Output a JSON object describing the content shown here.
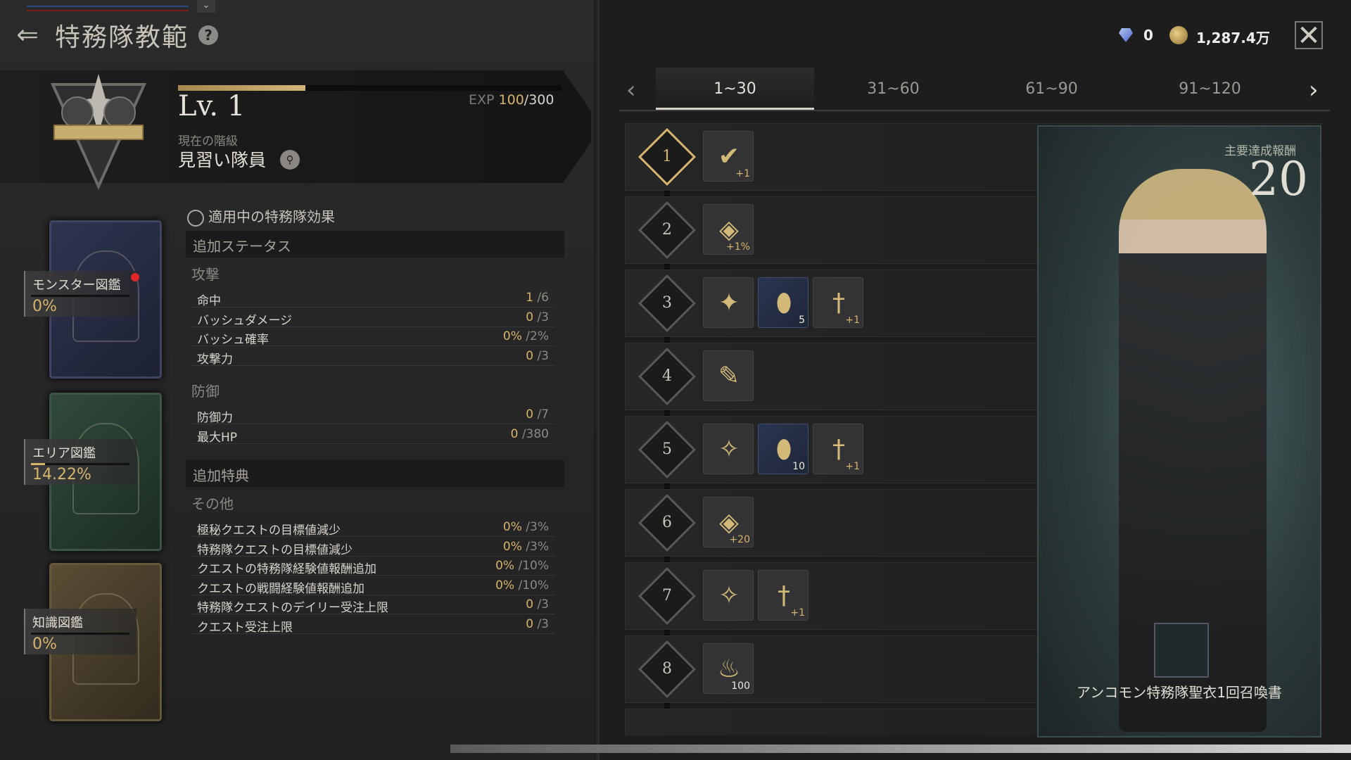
{
  "header": {
    "title": "特務隊教範",
    "help": "?",
    "back_icon": "back-arrow-icon"
  },
  "status": {
    "level": "Lv. 1",
    "exp_prefix": "EXP",
    "exp_current": "100",
    "exp_max": "/300",
    "exp_progress": 0.333,
    "rank_label": "現在の階級",
    "rank": "見習い隊員"
  },
  "books": [
    {
      "name": "モンスター図鑑",
      "percent": "0%",
      "progress": 0.0,
      "color": "#2e3450",
      "new": true
    },
    {
      "name": "エリア図鑑",
      "percent": "14.22%",
      "progress": 0.1422,
      "color": "#304a3c",
      "new": false
    },
    {
      "name": "知識図鑑",
      "percent": "0%",
      "progress": 0.0,
      "color": "#5a4d35",
      "new": false
    }
  ],
  "effects": {
    "title": "適用中の特務隊効果",
    "section1": "追加ステータス",
    "attack_label": "攻撃",
    "attack_rows": [
      {
        "label": "命中",
        "cur": "1",
        "max": "/6"
      },
      {
        "label": "バッシュダメージ",
        "cur": "0",
        "max": "/3"
      },
      {
        "label": "バッシュ確率",
        "cur": "0%",
        "max": "/2%"
      },
      {
        "label": "攻撃力",
        "cur": "0",
        "max": "/3"
      }
    ],
    "defense_label": "防御",
    "defense_rows": [
      {
        "label": "防御力",
        "cur": "0",
        "max": "/7"
      },
      {
        "label": "最大HP",
        "cur": "0",
        "max": "/380"
      }
    ],
    "section2": "追加特典",
    "other_label": "その他",
    "other_rows": [
      {
        "label": "極秘クエストの目標値減少",
        "cur": "0%",
        "max": "/3%"
      },
      {
        "label": "特務隊クエストの目標値減少",
        "cur": "0%",
        "max": "/3%"
      },
      {
        "label": "クエストの特務隊経験値報酬追加",
        "cur": "0%",
        "max": "/10%"
      },
      {
        "label": "クエストの戦闘経験値報酬追加",
        "cur": "0%",
        "max": "/10%"
      },
      {
        "label": "特務隊クエストのデイリー受注上限",
        "cur": "0",
        "max": "/3"
      },
      {
        "label": "クエスト受注上限",
        "cur": "0",
        "max": "/3"
      }
    ]
  },
  "currency": {
    "gems": "0",
    "gold": "1,287.4万",
    "gem_icon": "diamond-icon",
    "gold_icon": "coin-icon"
  },
  "tabs": [
    {
      "label": "1~30",
      "active": true
    },
    {
      "label": "31~60",
      "active": false
    },
    {
      "label": "61~90",
      "active": false
    },
    {
      "label": "91~120",
      "active": false
    }
  ],
  "levels": [
    {
      "num": "1",
      "active": true,
      "items": [
        {
          "icon": "check-icon",
          "glyph": "✔",
          "qty": "+1",
          "blue": false
        }
      ]
    },
    {
      "num": "2",
      "active": false,
      "items": [
        {
          "icon": "emblem-icon",
          "glyph": "◈",
          "qty": "+1%",
          "blue": false
        }
      ]
    },
    {
      "num": "3",
      "active": false,
      "items": [
        {
          "icon": "red-rune-icon",
          "glyph": "✦",
          "qty": "",
          "blue": false
        },
        {
          "icon": "gold-gem-icon",
          "glyph": "⬮",
          "qty": "5",
          "blue": true
        },
        {
          "icon": "sword-icon",
          "glyph": "†",
          "qty": "+1",
          "blue": false
        }
      ]
    },
    {
      "num": "4",
      "active": false,
      "items": [
        {
          "icon": "scroll-icon",
          "glyph": "✎",
          "qty": "",
          "blue": false
        }
      ]
    },
    {
      "num": "5",
      "active": false,
      "items": [
        {
          "icon": "blue-rune-icon",
          "glyph": "✧",
          "qty": "",
          "blue": false
        },
        {
          "icon": "gold-gem-icon",
          "glyph": "⬮",
          "qty": "10",
          "blue": true
        },
        {
          "icon": "sword-icon",
          "glyph": "†",
          "qty": "+1",
          "blue": false
        }
      ]
    },
    {
      "num": "6",
      "active": false,
      "items": [
        {
          "icon": "shield-emblem-icon",
          "glyph": "◈",
          "qty": "+20",
          "blue": false
        }
      ]
    },
    {
      "num": "7",
      "active": false,
      "items": [
        {
          "icon": "blue-rune-icon",
          "glyph": "✧",
          "qty": "",
          "blue": false
        },
        {
          "icon": "sword-icon",
          "glyph": "†",
          "qty": "+1",
          "blue": false
        }
      ]
    },
    {
      "num": "8",
      "active": false,
      "items": [
        {
          "icon": "blue-flame-icon",
          "glyph": "♨",
          "qty": "100",
          "blue": false
        }
      ]
    }
  ],
  "reward": {
    "label": "主要達成報酬",
    "level": "20",
    "item_name": "アンコモン特務隊聖衣1回召喚書"
  }
}
